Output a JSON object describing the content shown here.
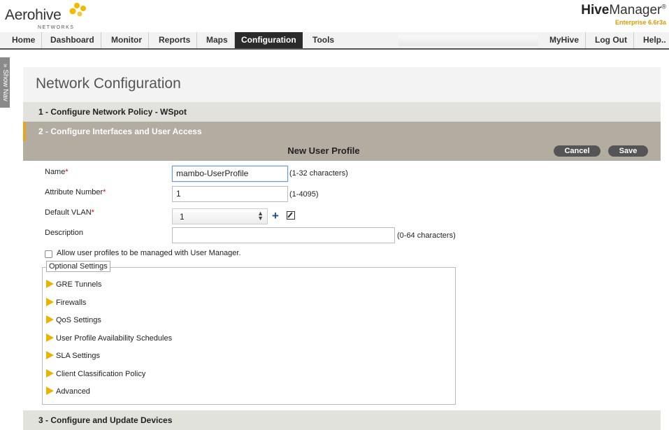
{
  "logo": {
    "word": "Aerohive",
    "sub": "NETWORKS",
    "dot_color": "#f5b800"
  },
  "brand": {
    "name_bold": "Hive",
    "name_rest": "Manager",
    "reg": "®",
    "edition": "Enterprise  6.6r3a"
  },
  "nav": {
    "items": [
      {
        "label": "Home"
      },
      {
        "label": "Dashboard"
      },
      {
        "label": "Monitor"
      },
      {
        "label": "Reports"
      },
      {
        "label": "Maps"
      },
      {
        "label": "Configuration"
      },
      {
        "label": "Tools"
      }
    ],
    "right_items": [
      {
        "label": "MyHive"
      },
      {
        "label": "Log Out"
      },
      {
        "label": "Help.."
      }
    ],
    "active": "Configuration"
  },
  "show_nav": "» Show Nav",
  "page_title": "Network Configuration",
  "steps": {
    "step1": "1 - Configure Network Policy - WSpot",
    "step2": "2 - Configure Interfaces and User Access",
    "step3": "3 - Configure and Update Devices"
  },
  "sub_header": {
    "title": "New User Profile",
    "cancel_label": "Cancel",
    "save_label": "Save"
  },
  "form": {
    "name": {
      "label": "Name",
      "required_mark": "*",
      "value": "mambo-UserProfile",
      "hint": "(1-32 characters)"
    },
    "attribute_number": {
      "label": "Attribute Number",
      "required_mark": "*",
      "value": "1",
      "hint": "(1-4095)"
    },
    "default_vlan": {
      "label": "Default VLAN",
      "required_mark": "*",
      "value": "1"
    },
    "description": {
      "label": "Description",
      "value": "",
      "hint": "(0-64 characters)"
    },
    "user_manager_checkbox": {
      "label": "Allow user profiles to be managed with User Manager.",
      "checked": false
    }
  },
  "optional_settings": {
    "legend": "Optional Settings",
    "items": [
      {
        "label": "GRE Tunnels"
      },
      {
        "label": "Firewalls"
      },
      {
        "label": "QoS Settings"
      },
      {
        "label": "User Profile Availability Schedules"
      },
      {
        "label": "SLA Settings"
      },
      {
        "label": "Client Classification Policy"
      },
      {
        "label": "Advanced"
      }
    ]
  },
  "colors": {
    "accent_orange": "#e9a41a",
    "active_nav": "#2b2b2b",
    "step_active_bg": "#b3aca1",
    "required": "#c00000",
    "expand_triangle": "#e8b400"
  }
}
